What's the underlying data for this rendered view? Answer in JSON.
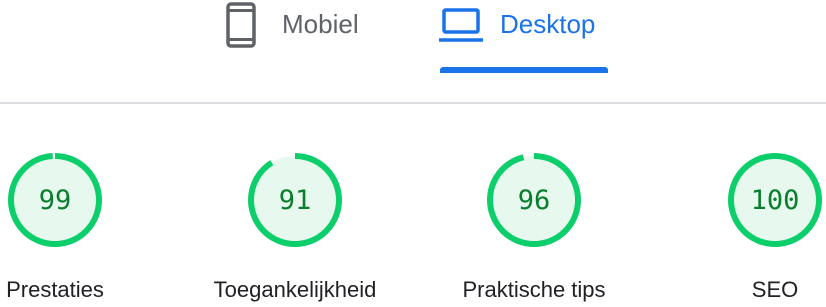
{
  "tabs": {
    "mobile": {
      "label": "Mobiel",
      "icon": "smartphone-icon",
      "selected": false
    },
    "desktop": {
      "label": "Desktop",
      "icon": "laptop-icon",
      "selected": true
    }
  },
  "colors": {
    "accent": "#1a73e8",
    "pass_ring": "#0cce6b",
    "pass_fill": "#e7f8ee",
    "pass_text": "#0a7d2e",
    "inactive": "#5f6368"
  },
  "scores": [
    {
      "value": "99",
      "score": 99,
      "label": "Prestaties"
    },
    {
      "value": "91",
      "score": 91,
      "label": "Toegankelijkheid"
    },
    {
      "value": "96",
      "score": 96,
      "label": "Praktische tips"
    },
    {
      "value": "100",
      "score": 100,
      "label": "SEO"
    }
  ]
}
